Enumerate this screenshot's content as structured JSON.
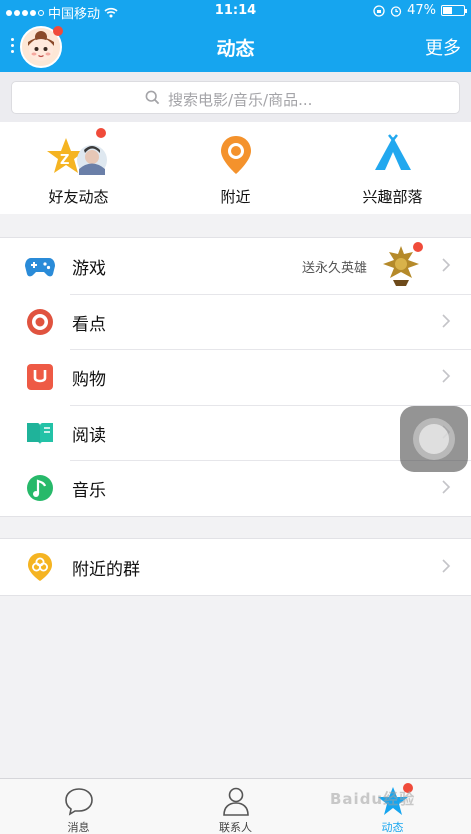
{
  "status_bar": {
    "carrier": "中国移动",
    "time": "11:14",
    "battery_text": "47%",
    "battery_level": 0.47
  },
  "header": {
    "title": "动态",
    "more_label": "更多"
  },
  "search": {
    "placeholder": "搜索电影/音乐/商品..."
  },
  "quick_entries": [
    {
      "label": "好友动态",
      "icon": "friends-feed-icon",
      "badge": true
    },
    {
      "label": "附近",
      "icon": "location-pin-icon",
      "badge": false
    },
    {
      "label": "兴趣部落",
      "icon": "tent-icon",
      "badge": false
    }
  ],
  "list": [
    {
      "label": "游戏",
      "icon": "gamepad-icon",
      "extra": "送永久英雄",
      "badge": true
    },
    {
      "label": "看点",
      "icon": "eye-icon"
    },
    {
      "label": "购物",
      "icon": "shopping-bag-icon"
    },
    {
      "label": "阅读",
      "icon": "book-icon"
    },
    {
      "label": "音乐",
      "icon": "music-note-icon"
    }
  ],
  "list2": [
    {
      "label": "附近的群",
      "icon": "nearby-group-icon"
    }
  ],
  "tabs": [
    {
      "label": "消息",
      "icon": "chat-bubble-icon",
      "active": false
    },
    {
      "label": "联系人",
      "icon": "contact-person-icon",
      "active": false
    },
    {
      "label": "动态",
      "icon": "star-feed-icon",
      "active": true,
      "badge": true
    }
  ],
  "watermark": "Baidu经验",
  "colors": {
    "brand_blue": "#16a5ef",
    "badge_red": "#f04b3a",
    "game_blue": "#2a8bd8",
    "kandian_red": "#e0533f",
    "shop_red": "#ee5a45",
    "read_teal": "#1fb39a",
    "music_green": "#27b96a",
    "group_yellow": "#f5b422"
  }
}
